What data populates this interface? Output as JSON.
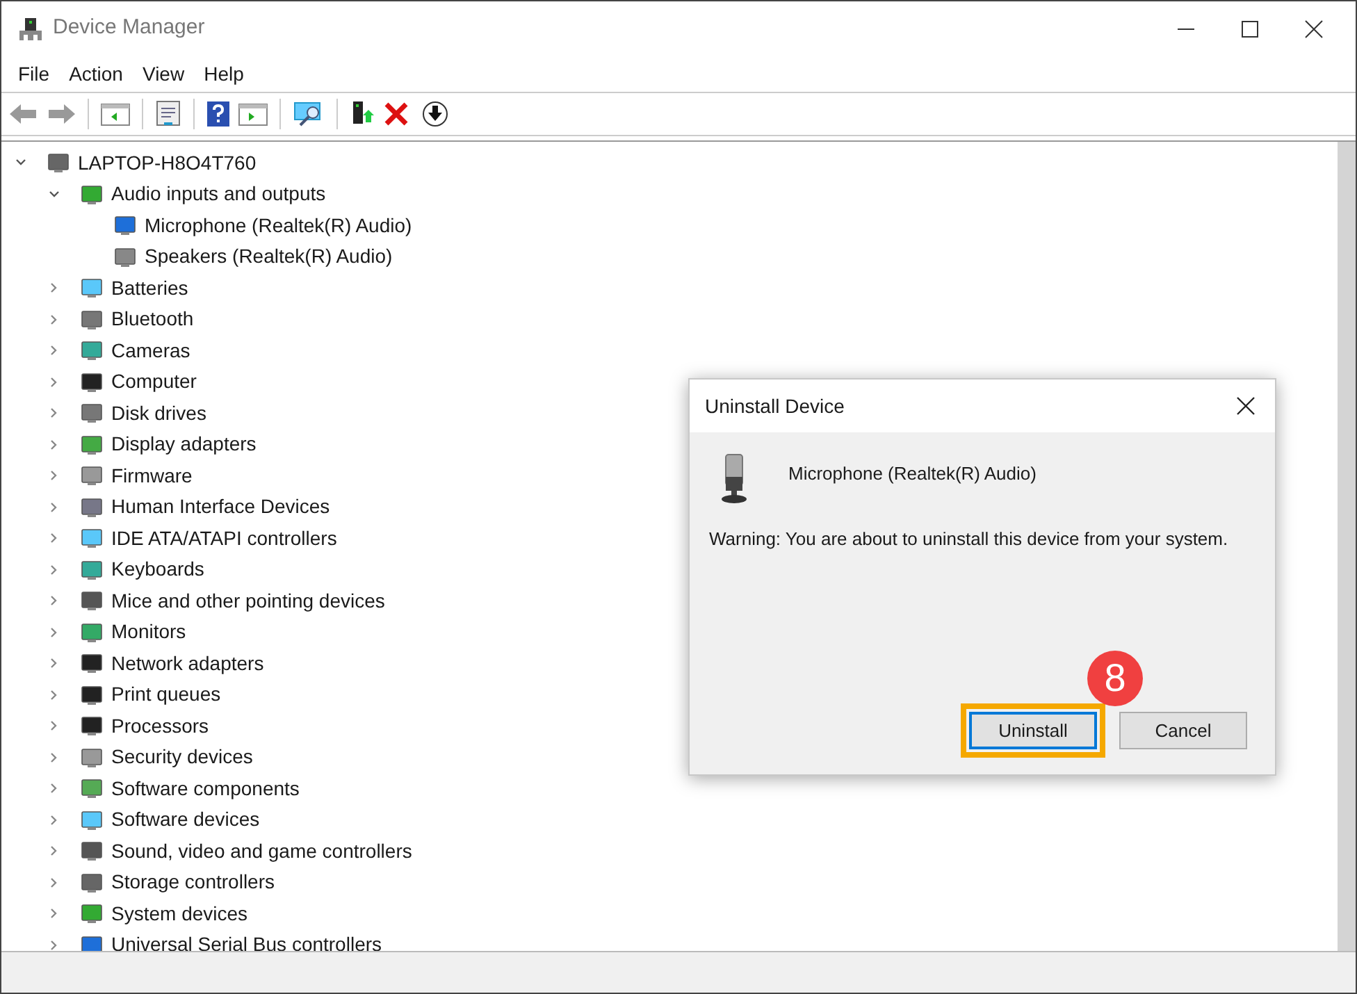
{
  "window": {
    "title": "Device Manager"
  },
  "menu": [
    "File",
    "Action",
    "View",
    "Help"
  ],
  "tree": [
    {
      "label": "LAPTOP-H8O4T760",
      "expanded": true,
      "children": [
        {
          "label": "Audio inputs and outputs",
          "expanded": true,
          "children": [
            {
              "label": "Microphone (Realtek(R) Audio)"
            },
            {
              "label": "Speakers (Realtek(R) Audio)"
            }
          ]
        },
        {
          "label": "Batteries",
          "expanded": false
        },
        {
          "label": "Bluetooth",
          "expanded": false
        },
        {
          "label": "Cameras",
          "expanded": false
        },
        {
          "label": "Computer",
          "expanded": false
        },
        {
          "label": "Disk drives",
          "expanded": false
        },
        {
          "label": "Display adapters",
          "expanded": false
        },
        {
          "label": "Firmware",
          "expanded": false
        },
        {
          "label": "Human Interface Devices",
          "expanded": false
        },
        {
          "label": "IDE ATA/ATAPI controllers",
          "expanded": false
        },
        {
          "label": "Keyboards",
          "expanded": false
        },
        {
          "label": "Mice and other pointing devices",
          "expanded": false
        },
        {
          "label": "Monitors",
          "expanded": false
        },
        {
          "label": "Network adapters",
          "expanded": false
        },
        {
          "label": "Print queues",
          "expanded": false
        },
        {
          "label": "Processors",
          "expanded": false
        },
        {
          "label": "Security devices",
          "expanded": false
        },
        {
          "label": "Software components",
          "expanded": false
        },
        {
          "label": "Software devices",
          "expanded": false
        },
        {
          "label": "Sound, video and game controllers",
          "expanded": false
        },
        {
          "label": "Storage controllers",
          "expanded": false
        },
        {
          "label": "System devices",
          "expanded": false
        },
        {
          "label": "Universal Serial Bus controllers",
          "expanded": false
        }
      ]
    }
  ],
  "dialog": {
    "title": "Uninstall Device",
    "device": "Microphone (Realtek(R) Audio)",
    "warning": "Warning: You are about to uninstall this device from your system.",
    "buttons": [
      {
        "label": "Uninstall",
        "highlighted": true
      },
      {
        "label": "Cancel",
        "highlighted": false
      }
    ]
  },
  "annotation": {
    "step": "8"
  }
}
